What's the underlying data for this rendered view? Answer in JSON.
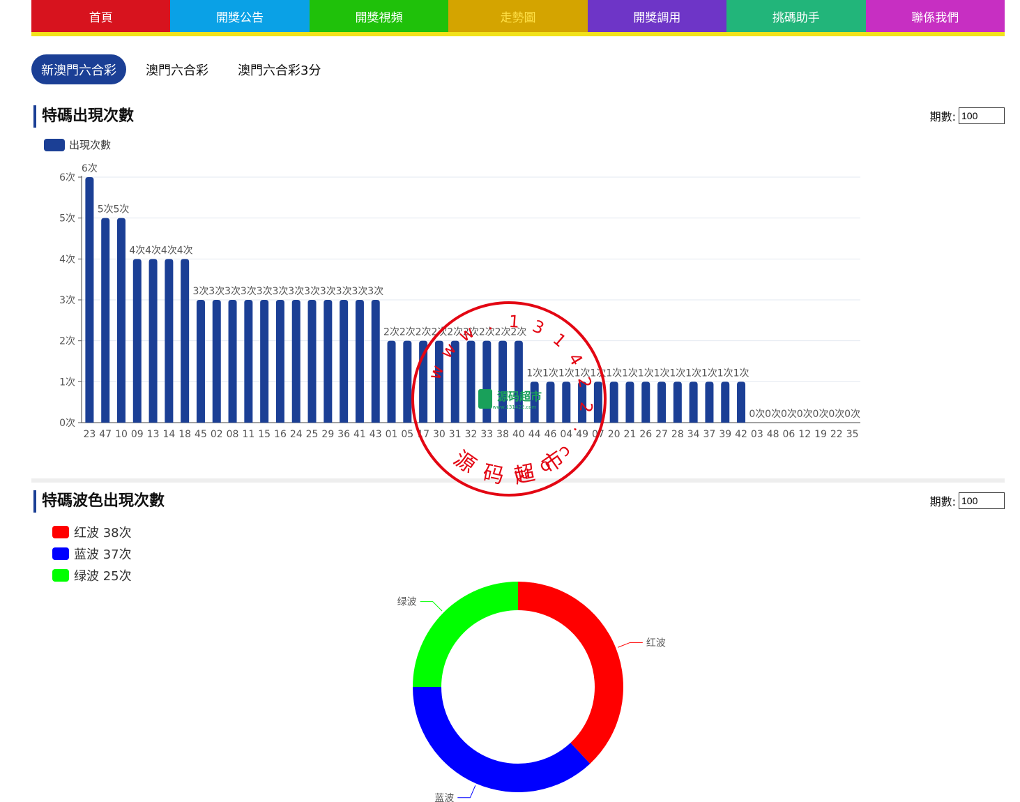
{
  "nav": {
    "items": [
      {
        "label": "首頁",
        "color": "#d7131e"
      },
      {
        "label": "開獎公告",
        "color": "#0aa1e6"
      },
      {
        "label": "開獎視頻",
        "color": "#1fc10a"
      },
      {
        "label": "走勢圖",
        "color": "#d4a400",
        "text_color": "#ffe046"
      },
      {
        "label": "開獎調用",
        "color": "#6e35c7"
      },
      {
        "label": "挑碼助手",
        "color": "#22b57a"
      },
      {
        "label": "聯係我們",
        "color": "#c72fc2"
      }
    ],
    "underline_color": "#f2e21a"
  },
  "lottery_tabs": [
    {
      "label": "新澳門六合彩",
      "active": true
    },
    {
      "label": "澳門六合彩",
      "active": false
    },
    {
      "label": "澳門六合彩3分",
      "active": false
    }
  ],
  "section1": {
    "title": "特碼出現次數",
    "period_label": "期數:",
    "period_value": "100"
  },
  "section2": {
    "title": "特碼波色出現次數",
    "period_label": "期數:",
    "period_value": "100"
  },
  "chart_data": [
    {
      "type": "bar",
      "legend": "出現次數",
      "color": "#1b3f95",
      "value_suffix": "次",
      "categories": [
        "23",
        "47",
        "10",
        "09",
        "13",
        "14",
        "18",
        "45",
        "02",
        "08",
        "11",
        "15",
        "16",
        "24",
        "25",
        "29",
        "36",
        "41",
        "43",
        "01",
        "05",
        "17",
        "30",
        "31",
        "32",
        "33",
        "38",
        "40",
        "44",
        "46",
        "04",
        "49",
        "07",
        "20",
        "21",
        "26",
        "27",
        "28",
        "34",
        "37",
        "39",
        "42",
        "03",
        "48",
        "06",
        "12",
        "19",
        "22",
        "35"
      ],
      "values": [
        6,
        5,
        5,
        4,
        4,
        4,
        4,
        3,
        3,
        3,
        3,
        3,
        3,
        3,
        3,
        3,
        3,
        3,
        3,
        2,
        2,
        2,
        2,
        2,
        2,
        2,
        2,
        2,
        1,
        1,
        1,
        1,
        1,
        1,
        1,
        1,
        1,
        1,
        1,
        1,
        1,
        1,
        0,
        0,
        0,
        0,
        0,
        0,
        0
      ],
      "yticks": [
        "0次",
        "1次",
        "2次",
        "3次",
        "4次",
        "5次",
        "6次"
      ],
      "ylim": [
        0,
        6
      ],
      "grid": true,
      "legend_position": "top-left"
    },
    {
      "type": "pie",
      "donut": true,
      "slices": [
        {
          "name": "红波",
          "value": 38,
          "color": "#ff0000",
          "legend_text": "红波 38次"
        },
        {
          "name": "蓝波",
          "value": 37,
          "color": "#0000ff",
          "legend_text": "蓝波 37次"
        },
        {
          "name": "绿波",
          "value": 25,
          "color": "#00ff00",
          "legend_text": "绿波 25次"
        }
      ],
      "legend_position": "top-left"
    }
  ],
  "watermark": {
    "url_text": "www.131422.com",
    "name_text": "源码超市",
    "badge_text": "源码超市",
    "badge_sub": "www.131422.com",
    "color": "#e30613"
  }
}
